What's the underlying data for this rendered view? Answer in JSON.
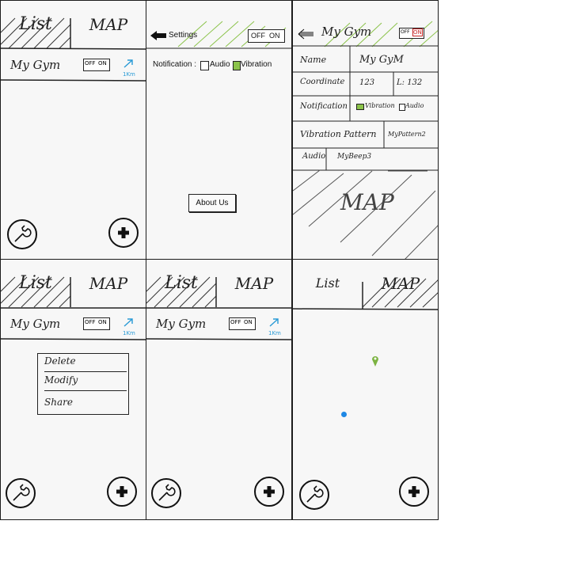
{
  "list_screen": {
    "tab_list": "List",
    "tab_map": "MAP",
    "item_name": "My Gym",
    "toggle_off": "OFF",
    "toggle_on": "ON",
    "distance": "1Km"
  },
  "settings_screen": {
    "title": "Settings",
    "toggle_off": "OFF",
    "toggle_on": "ON",
    "notification_label": "Notification :",
    "audio_label": "Audio",
    "vibration_label": "Vibration",
    "about_button": "About Us"
  },
  "detail_screen": {
    "title": "My Gym",
    "toggle_off": "OFF",
    "toggle_on": "ON",
    "name_label": "Name",
    "name_value": "My GyM",
    "coordinate_label": "Coordinate",
    "coord_lat": "123",
    "coord_lng": "L: 132",
    "notification_label": "Notification",
    "notif_vibration": "Vibration",
    "notif_audio": "Audio",
    "vibration_pattern_label": "Vibration Pattern",
    "vibration_pattern_value": "MyPattern2",
    "audio_label": "Audio",
    "audio_value": "MyBeep3",
    "map_label": "MAP"
  },
  "context_menu": {
    "items": [
      "Delete",
      "Modify",
      "Share"
    ]
  },
  "icons": {
    "back": "back-arrow-icon",
    "wrench": "wrench-icon",
    "plus": "plus-icon",
    "navigate": "navigate-arrow-icon",
    "pin_green": "map-pin-icon",
    "location_dot": "current-location-icon"
  },
  "colors": {
    "accent_green": "#8bc34a",
    "link_blue": "#2a9bd6",
    "pin_green": "#7cb342",
    "dot_blue": "#1e88e5",
    "toggle_on_red": "#c62828"
  }
}
